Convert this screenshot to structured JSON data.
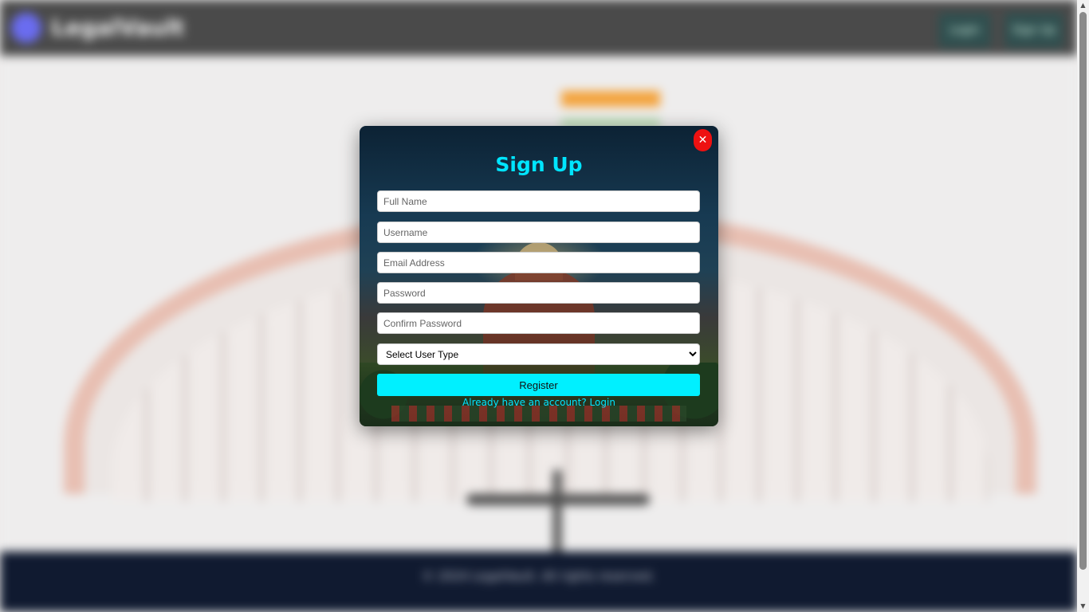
{
  "header": {
    "logo_text": "LegalVault",
    "login_label": "Login",
    "signup_label": "Sign Up"
  },
  "footer": {
    "copyright": "© 2024 LegalVault. All rights reserved.",
    "subtext": ""
  },
  "modal": {
    "title": "Sign Up",
    "close_symbol": "✕",
    "fields": {
      "full_name": {
        "placeholder": "Full Name",
        "value": ""
      },
      "username": {
        "placeholder": "Username",
        "value": ""
      },
      "email": {
        "placeholder": "Email Address",
        "value": ""
      },
      "password": {
        "placeholder": "Password",
        "value": ""
      },
      "confirm_password": {
        "placeholder": "Confirm Password",
        "value": ""
      }
    },
    "user_type": {
      "selected": "Select User Type",
      "options": [
        "Select User Type"
      ]
    },
    "register_label": "Register",
    "login_link": "Already have an account? Login"
  },
  "colors": {
    "accent": "#00e5ff",
    "register_bg": "#00f0ff",
    "close_bg": "#ee1111",
    "navbar_bg": "#4a4a4a",
    "footer_bg": "#101a30"
  },
  "icons": {
    "close": "close-icon",
    "logo": "logo-icon",
    "dropdown": "chevron-down-icon"
  }
}
